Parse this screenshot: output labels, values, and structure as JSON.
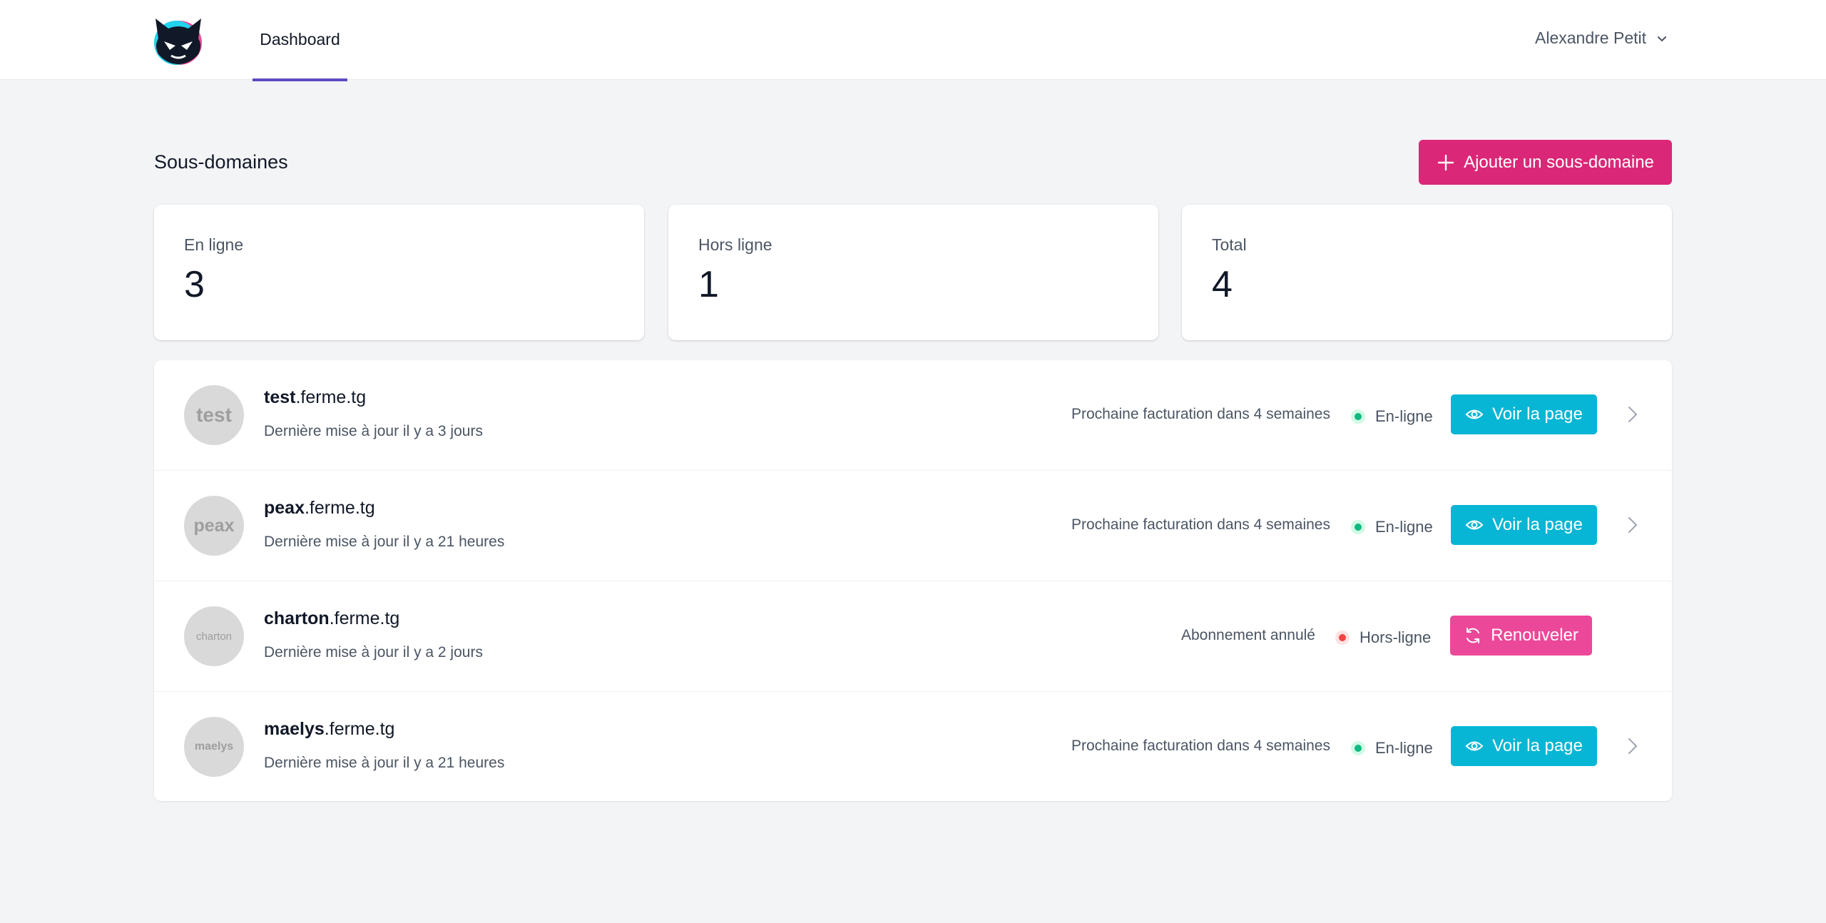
{
  "header": {
    "logo_alt": "devil-logo",
    "nav_tab": "Dashboard",
    "user_name": "Alexandre Petit"
  },
  "section": {
    "title": "Sous-domaines",
    "add_button": "Ajouter un sous-domaine"
  },
  "stats": [
    {
      "label": "En ligne",
      "value": "3"
    },
    {
      "label": "Hors ligne",
      "value": "1"
    },
    {
      "label": "Total",
      "value": "4"
    }
  ],
  "subdomains": [
    {
      "avatar": "test",
      "name": "test",
      "suffix": ".ferme.tg",
      "updated": "Dernière mise à jour il y a 3 jours",
      "billing": "Prochaine facturation dans 4 semaines",
      "status": "En-ligne",
      "status_color": "#10b981",
      "action": "Voir la page"
    },
    {
      "avatar": "peax",
      "name": "peax",
      "suffix": ".ferme.tg",
      "updated": "Dernière mise à jour il y a 21 heures",
      "billing": "Prochaine facturation dans 4 semaines",
      "status": "En-ligne",
      "status_color": "#10b981",
      "action": "Voir la page"
    },
    {
      "avatar": "charton",
      "name": "charton",
      "suffix": ".ferme.tg",
      "updated": "Dernière mise à jour il y a 2 jours",
      "billing": "Abonnement annulé",
      "status": "Hors-ligne",
      "status_color": "#ef4444",
      "action": "Renouveler"
    },
    {
      "avatar": "maelys",
      "name": "maelys",
      "suffix": ".ferme.tg",
      "updated": "Dernière mise à jour il y a 21 heures",
      "billing": "Prochaine facturation dans 4 semaines",
      "status": "En-ligne",
      "status_color": "#10b981",
      "action": "Voir la page"
    }
  ],
  "colors": {
    "accent": "#db2777",
    "view_button": "#06b6d4",
    "renew_button": "#ec4899",
    "nav_underline": "#5b4cc4"
  }
}
